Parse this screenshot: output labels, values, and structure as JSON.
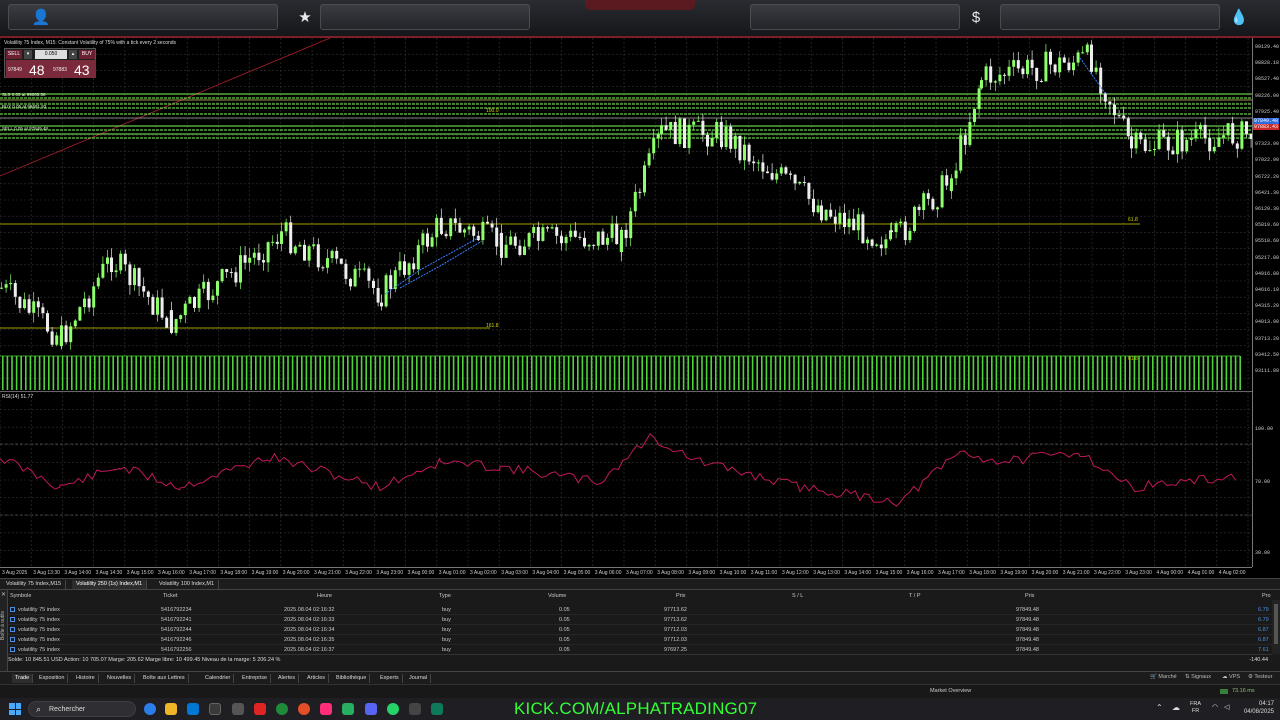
{
  "topbar": {
    "icons": [
      "user-icon",
      "star-icon",
      "dollar-icon",
      "drop-icon"
    ],
    "glyphs": {
      "user": "👤",
      "star": "★",
      "dollar": "$",
      "drop": "💧"
    }
  },
  "chart": {
    "title": "Volatility 75 Index, M15: Constant Volatility of 75% with a tick every 2 seconds",
    "trade_panel": {
      "sell_label": "SELL",
      "buy_label": "BUY",
      "lots": "0.050",
      "bid_small": "97849",
      "bid_big": "48",
      "ask_small": "97883",
      "ask_big": "43"
    },
    "line_labels": {
      "level_1": "SLS 0.05 at 99065.56",
      "level_2": "BUY 0.05 at 98691.93",
      "level_3": "SELL 0.05 at 97849.48",
      "fib_top": "100.0",
      "fib_mid": "61.8",
      "fib_low": "161.8",
      "fib_bottom": "61.8"
    },
    "price_axis": [
      "99129.40",
      "98828.18",
      "98527.40",
      "98226.00",
      "97925.40",
      "97624.70",
      "97323.90",
      "97022.90",
      "96722.20",
      "96421.30",
      "96120.30",
      "95819.60",
      "95518.60",
      "95217.80",
      "94916.80",
      "94616.10",
      "94315.20",
      "94013.90",
      "93713.20",
      "93412.50",
      "93111.80"
    ],
    "price_tags": {
      "current": "97849.48",
      "sell": "97883.43"
    },
    "time_axis": [
      "3 Aug 2025",
      "3 Aug 13:30",
      "3 Aug 14:00",
      "3 Aug 14:30",
      "3 Aug 15:00",
      "3 Aug 16:00",
      "3 Aug 17:00",
      "3 Aug 18:00",
      "3 Aug 19:00",
      "3 Aug 20:00",
      "3 Aug 21:00",
      "3 Aug 22:00",
      "3 Aug 23:00",
      "3 Aug 00:00",
      "3 Aug 01:00",
      "3 Aug 02:00",
      "3 Aug 03:00",
      "3 Aug 04:00",
      "3 Aug 05:00",
      "3 Aug 06:00",
      "3 Aug 07:00",
      "3 Aug 08:00",
      "3 Aug 09:00",
      "3 Aug 10:00",
      "3 Aug 11:00",
      "3 Aug 12:00",
      "3 Aug 13:00",
      "3 Aug 14:00",
      "3 Aug 15:00",
      "3 Aug 16:00",
      "3 Aug 17:00",
      "3 Aug 18:00",
      "3 Aug 19:00",
      "3 Aug 20:00",
      "3 Aug 21:00",
      "3 Aug 22:00",
      "3 Aug 23:00",
      "4 Aug 00:00",
      "4 Aug 01:00",
      "4 Aug 02:00"
    ]
  },
  "rsi": {
    "title": "RSI(14) 51.77",
    "levels": [
      "100.00",
      "70.00",
      "30.00"
    ]
  },
  "chart_tabs": [
    "Volatility 75 Index,M15",
    "Volatility 250 (1s) Index,M1",
    "Volatility 100 Index,M1"
  ],
  "terminal": {
    "headers": {
      "symbol": "Symbole",
      "ticket": "Ticket",
      "time": "Heure",
      "type": "Type",
      "volume": "Volume",
      "price": "Prix",
      "sl": "S / L",
      "tp": "T / P",
      "cur_price": "Prix",
      "profit": "Pro"
    },
    "side_label": "Boîte à outils",
    "rows": [
      {
        "symbol": "volatility 75 index",
        "ticket": "5416792234",
        "time": "2025.08.04 02:16:32",
        "type": "buy",
        "volume": "0.05",
        "price": "97713.62",
        "cur": "97849.48",
        "profit": "6.79"
      },
      {
        "symbol": "volatility 75 index",
        "ticket": "5416792241",
        "time": "2025.08.04 02:16:33",
        "type": "buy",
        "volume": "0.05",
        "price": "97713.62",
        "cur": "97849.48",
        "profit": "6.79"
      },
      {
        "symbol": "volatility 75 index",
        "ticket": "5416792244",
        "time": "2025.08.04 02:16:34",
        "type": "buy",
        "volume": "0.05",
        "price": "97712.03",
        "cur": "97849.48",
        "profit": "6.87"
      },
      {
        "symbol": "volatility 75 index",
        "ticket": "5416792246",
        "time": "2025.08.04 02:16:35",
        "type": "buy",
        "volume": "0.05",
        "price": "97712.03",
        "cur": "97849.48",
        "profit": "6.87"
      },
      {
        "symbol": "volatility 75 index",
        "ticket": "5416792256",
        "time": "2025.08.04 02:16:37",
        "type": "buy",
        "volume": "0.05",
        "price": "97697.25",
        "cur": "97849.48",
        "profit": "7.61"
      }
    ],
    "balance": "Solde: 10 845.51 USD  Action: 10 705.07  Marge: 205.62  Marge libre: 10 499.45  Niveau de la marge: 5 206.24 %",
    "total": "-140.44"
  },
  "term_tabs": [
    "Trade",
    "Exposition",
    "Histoire",
    "Nouvelles",
    "Boîte aux Lettres",
    "Calendrier",
    "Entreprise",
    "Alertes",
    "Articles",
    "Bibliothèque",
    "Experts",
    "Journal"
  ],
  "term_right": {
    "market": "Marché",
    "signals": "Signaux",
    "vps": "VPS",
    "tester": "Testeur"
  },
  "status": {
    "market_overview": "Market Overview",
    "ping": "73.16 ms"
  },
  "taskbar": {
    "search_placeholder": "Rechercher",
    "stream_text": "KICK.COM/ALPHATRADING07",
    "lang1": "FRA",
    "lang2": "FR",
    "time": "04:17",
    "date": "04/08/2025"
  },
  "colors": {
    "bull": "#8cff6a",
    "bear": "#eeeeee",
    "grid": "#333333",
    "rsi": "#c2185b",
    "level": "#d4d400",
    "profit": "#4d8fe0",
    "accent": "#7a1f27"
  }
}
